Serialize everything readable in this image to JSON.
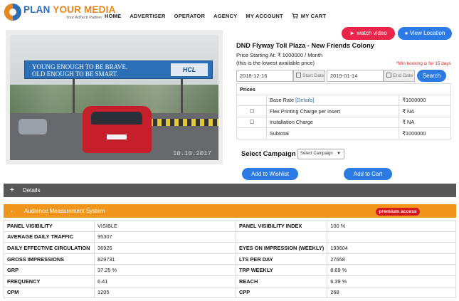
{
  "header": {
    "logo_plan": "PLAN",
    "logo_your_media": "YOUR MEDIA",
    "logo_tag": "Your AdTech Partner",
    "nav": [
      "HOME",
      "ADVERTISER",
      "OPERATOR",
      "AGENCY",
      "MY ACCOUNT",
      "MY CART"
    ]
  },
  "photo": {
    "billboard_text_line1": "YOUNG ENOUGH TO BE BRAVE.",
    "billboard_text_line2": "OLD ENOUGH TO BE SMART.",
    "billboard_brand": "HCL",
    "watermark": "10.10.2017"
  },
  "actions": {
    "watch_video": "watch video",
    "view_location": "View Location"
  },
  "listing": {
    "title": "DND Flyway Toll Plaza - New Friends Colony",
    "price_line": "Price Starting At: ₹ 1000000 / Month",
    "lowest_note": "(this is the lowest available price)",
    "min_booking": "*Min booking is for 15 days"
  },
  "dates": {
    "start_value": "2018-12-16",
    "start_label": "Start Date",
    "end_value": "2019-01-14",
    "end_label": "End Date",
    "search": "Search"
  },
  "prices": {
    "header": "Prices",
    "rows": [
      {
        "label": "Base Rate",
        "link": "[Details]",
        "value": "₹1000000"
      },
      {
        "label": "Flex Printing Charge per insert",
        "value": "₹ NA"
      },
      {
        "label": "Installation Charge",
        "value": "₹ NA"
      },
      {
        "label": "Subtotal",
        "value": "₹1000000"
      }
    ]
  },
  "campaign": {
    "label": "Select Campaign",
    "select_value": "Select Campaign",
    "wishlist": "Add to Wishlist",
    "cart": "Add to Cart"
  },
  "details": {
    "toggle": "+",
    "label": "Details"
  },
  "audience": {
    "toggle": "-",
    "label": "Audience Measurement System",
    "badge": "premium access",
    "rows": [
      {
        "k1": "PANEL VISIBILITY",
        "v1": "VISIBLE",
        "k2": "PANEL VISIBILITY INDEX",
        "v2": "100 %"
      },
      {
        "k1": "AVERAGE DAILY TRAFFIC",
        "v1": "95307",
        "k2": "",
        "v2": ""
      },
      {
        "k1": "DAILY EFFECTIVE CIRCULATION",
        "v1": "36926",
        "k2": "EYES ON IMPRESSION (WEEKLY)",
        "v2": "193604"
      },
      {
        "k1": "GROSS IMPRESSIONS",
        "v1": "829731",
        "k2": "LTS PER DAY",
        "v2": "27658"
      },
      {
        "k1": "GRP",
        "v1": "37.25 %",
        "k2": "TRP WEEKLY",
        "v2": "8.69 %"
      },
      {
        "k1": "FREQUENCY",
        "v1": "6.41",
        "k2": "REACH",
        "v2": "6.39 %"
      },
      {
        "k1": "CPM",
        "v1": "1205",
        "k2": "CPP",
        "v2": "268"
      }
    ]
  },
  "colors": {
    "brand_blue": "#2f6db5",
    "brand_orange": "#e8871e",
    "button_blue": "#2c7be5",
    "watch_red": "#e8264b",
    "audience_orange": "#f0961c",
    "premium_red": "#d6191b",
    "details_grey": "#575757"
  }
}
